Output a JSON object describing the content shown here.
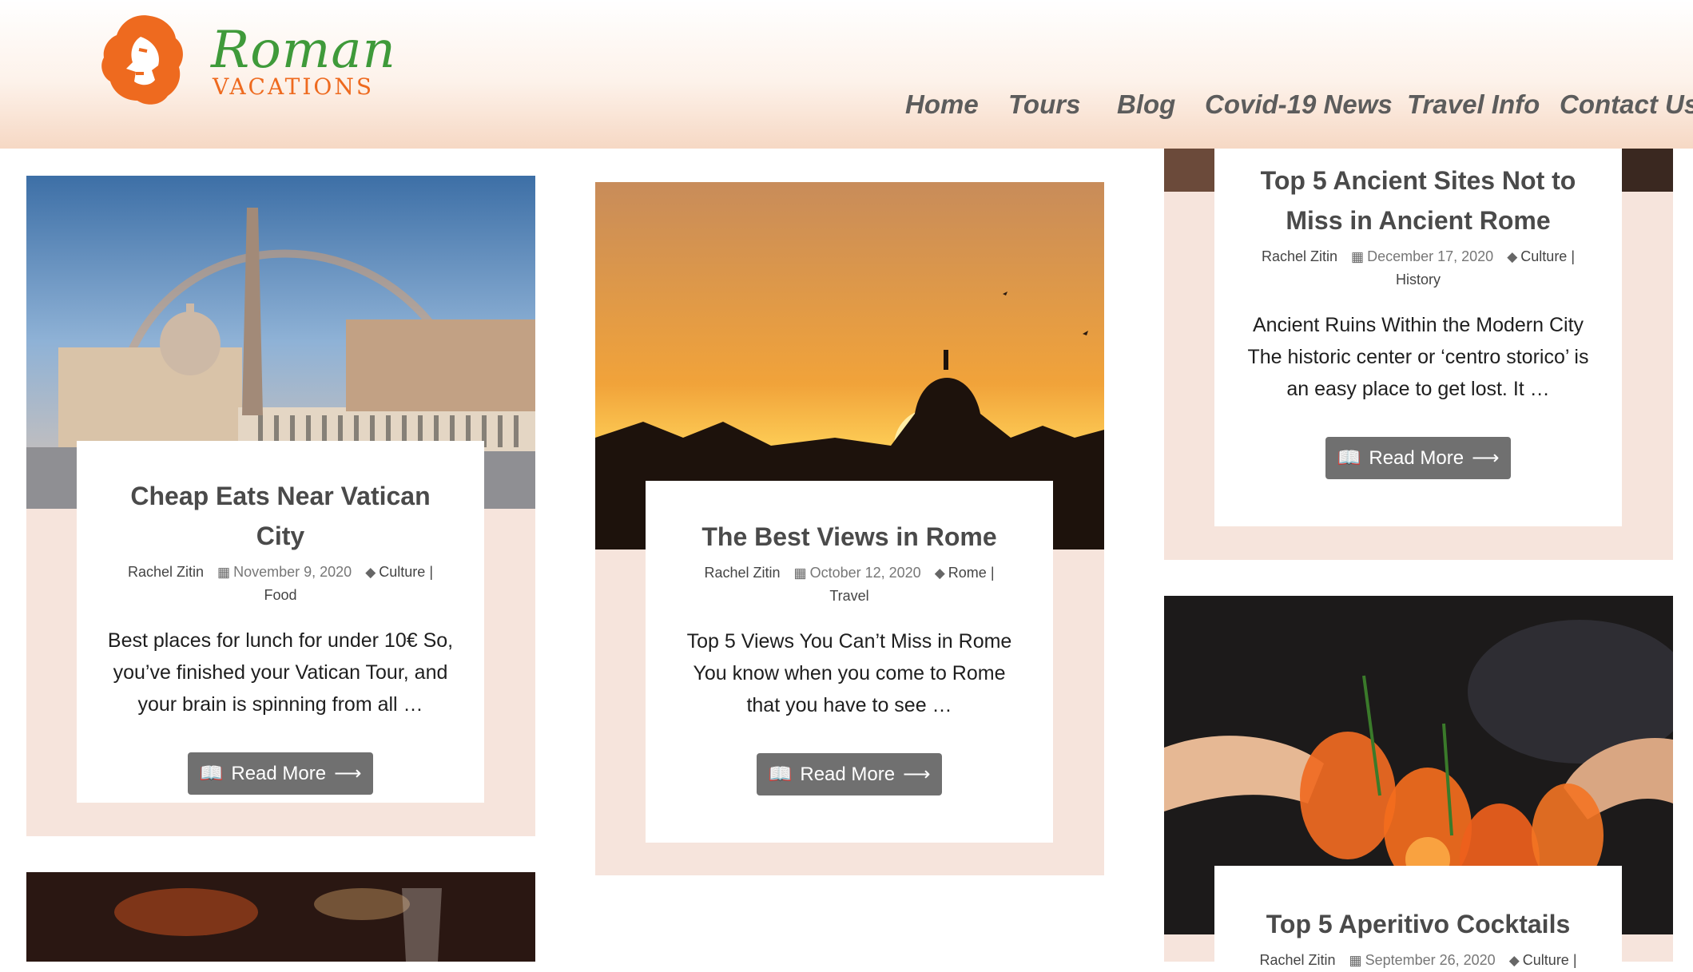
{
  "header": {
    "logo": {
      "word": "Roman",
      "sub": "VACATIONS"
    },
    "nav": [
      "Home",
      "Tours",
      "Blog",
      "Covid-19 News",
      "Travel Info",
      "Contact Us"
    ]
  },
  "colors": {
    "card_bg": "#f6e4dc",
    "button": "#707070",
    "logo_orange": "#ee6a1f",
    "logo_green": "#3f9a3a"
  },
  "posts": [
    {
      "title": "Cheap Eats Near Vatican City",
      "author": "Rachel Zitin",
      "date": "November 9, 2020",
      "categories": "Culture",
      "sep": "|",
      "categories_line2": "Food",
      "excerpt": "Best places for lunch for under 10€ So, you’ve finished your Vatican Tour, and your brain is spinning from all …",
      "button": "Read More",
      "image_icon": "st-peters-square-photo"
    },
    {
      "title": "The Best Views in Rome",
      "author": "Rachel Zitin",
      "date": "October 12, 2020",
      "categories": "Rome",
      "sep": "|",
      "categories_line2": "Travel",
      "excerpt": "Top 5 Views You Can’t Miss in Rome You know when you come to Rome that you have to see …",
      "button": "Read More",
      "image_icon": "rome-sunset-photo"
    },
    {
      "title": "Top 5 Ancient Sites Not to Miss in Ancient Rome",
      "author": "Rachel Zitin",
      "date": "December 17, 2020",
      "categories": "Culture",
      "sep": "|",
      "categories_line2": "History",
      "excerpt": "Ancient Ruins Within the Modern City The historic center or ‘centro storico’ is an easy place to get lost. It …",
      "button": "Read More",
      "image_icon": "ancient-ruins-photo"
    },
    {
      "title": "Top 5 Aperitivo Cocktails",
      "author": "Rachel Zitin",
      "date": "September 26, 2020",
      "categories": "Culture",
      "sep": "|",
      "image_icon": "aperitivo-cocktails-photo"
    }
  ]
}
